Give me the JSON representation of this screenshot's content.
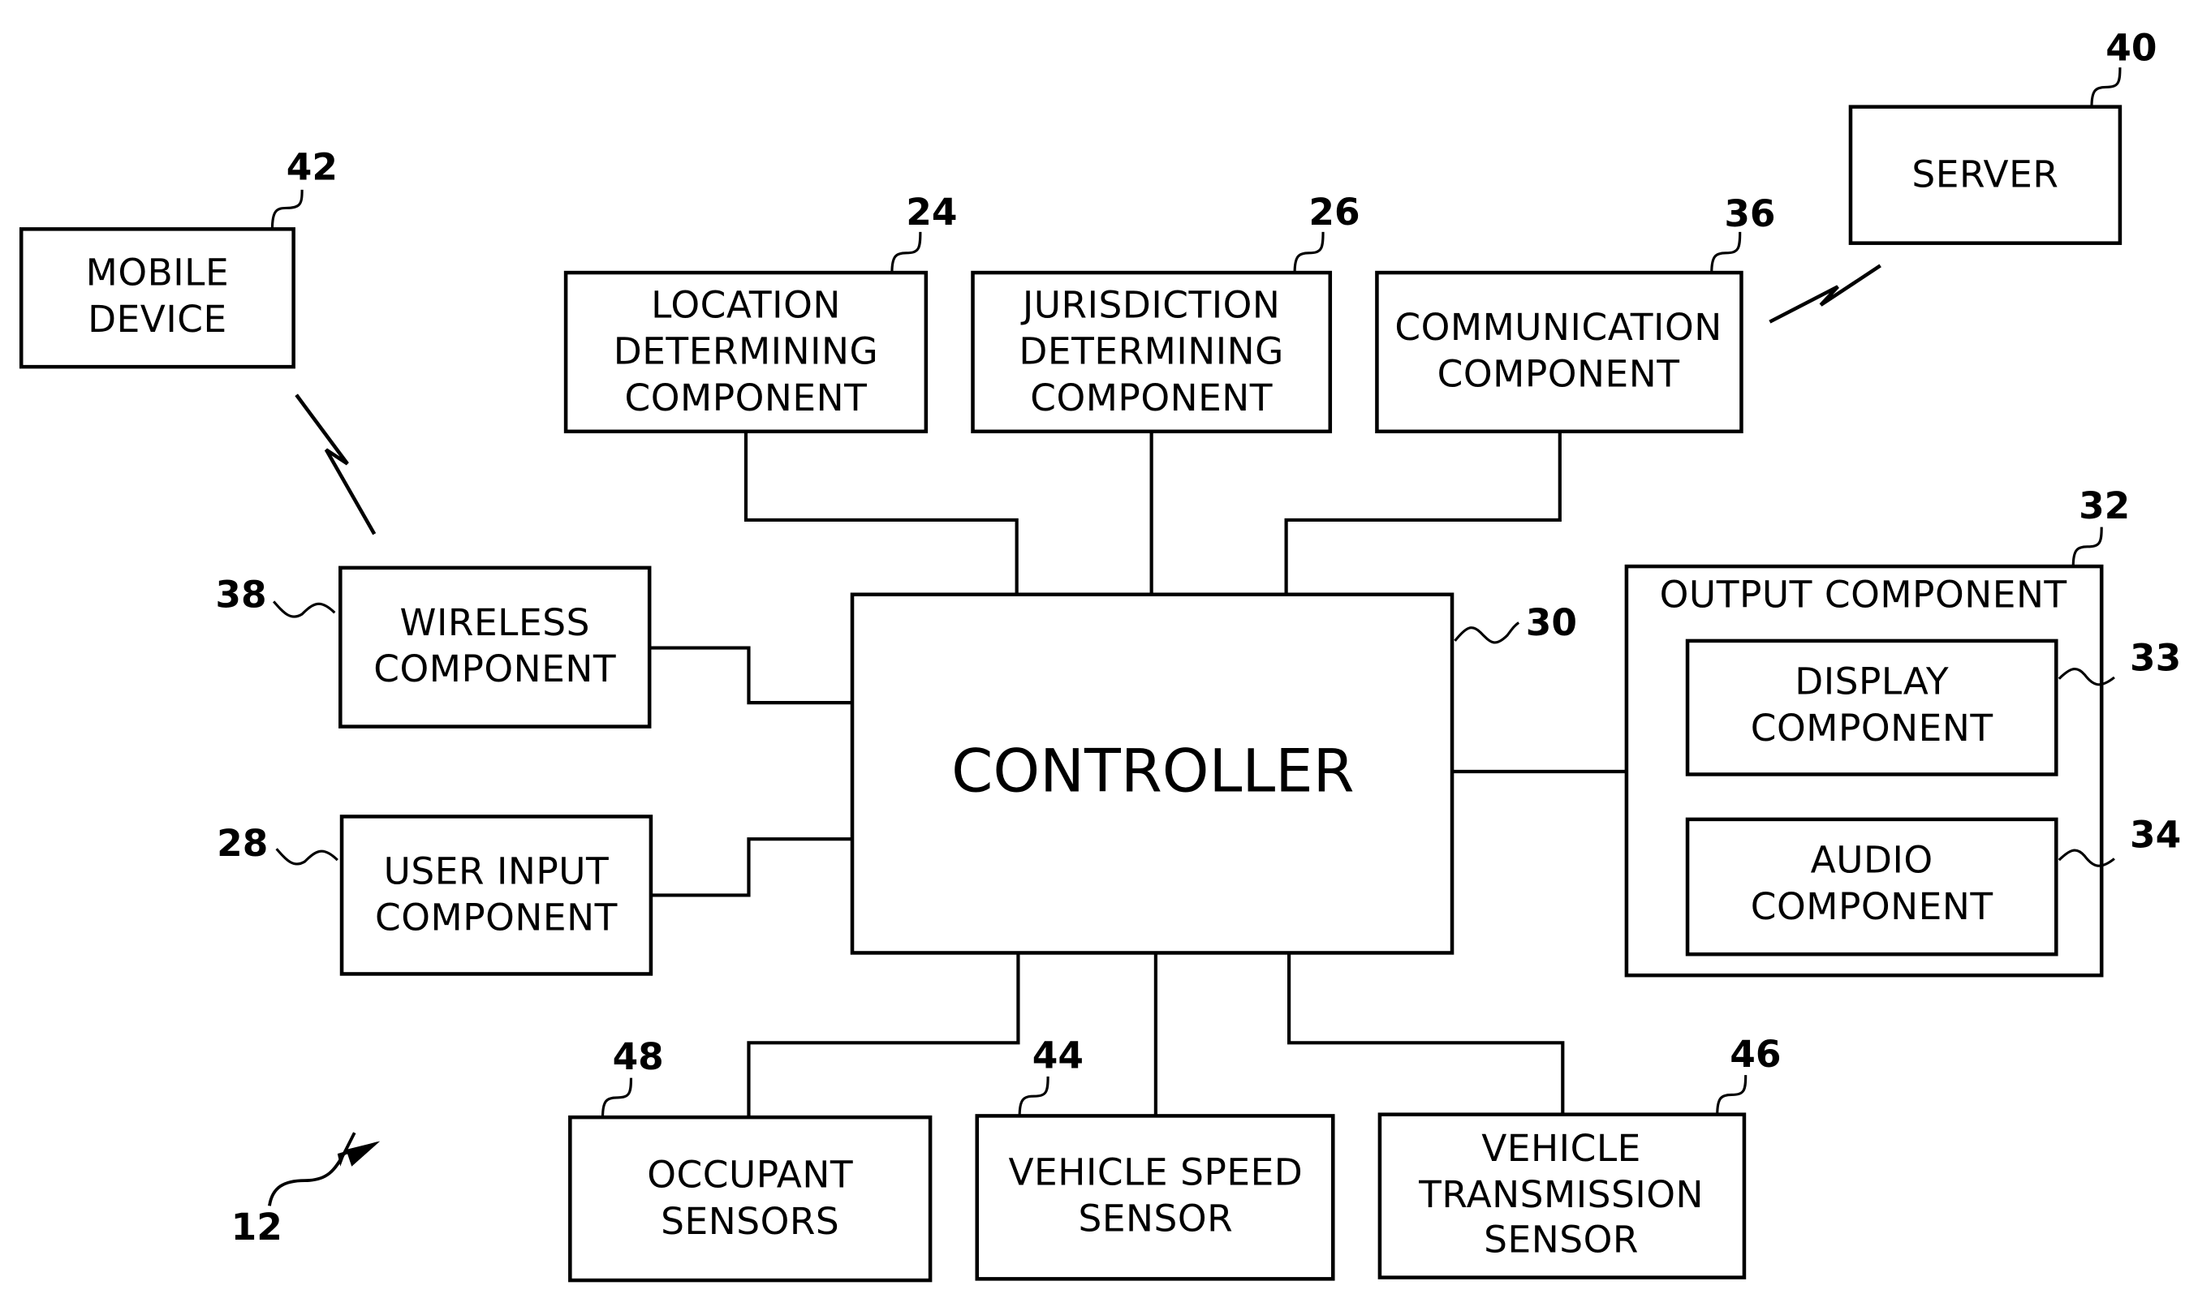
{
  "diagram": {
    "type": "block-diagram",
    "system_ref": "12",
    "blocks": {
      "mobile_device": {
        "ref": "42",
        "lines": [
          "MOBILE",
          "DEVICE"
        ]
      },
      "location": {
        "ref": "24",
        "lines": [
          "LOCATION",
          "DETERMINING",
          "COMPONENT"
        ]
      },
      "jurisdiction": {
        "ref": "26",
        "lines": [
          "JURISDICTION",
          "DETERMINING",
          "COMPONENT"
        ]
      },
      "communication": {
        "ref": "36",
        "lines": [
          "COMMUNICATION",
          "COMPONENT"
        ]
      },
      "server": {
        "ref": "40",
        "lines": [
          "SERVER"
        ]
      },
      "wireless": {
        "ref": "38",
        "lines": [
          "WIRELESS",
          "COMPONENT"
        ]
      },
      "user_input": {
        "ref": "28",
        "lines": [
          "USER INPUT",
          "COMPONENT"
        ]
      },
      "controller": {
        "ref": "30",
        "lines": [
          "CONTROLLER"
        ]
      },
      "output": {
        "ref": "32",
        "lines": [
          "OUTPUT COMPONENT"
        ]
      },
      "display": {
        "ref": "33",
        "lines": [
          "DISPLAY",
          "COMPONENT"
        ]
      },
      "audio": {
        "ref": "34",
        "lines": [
          "AUDIO",
          "COMPONENT"
        ]
      },
      "occupant": {
        "ref": "48",
        "lines": [
          "OCCUPANT",
          "SENSORS"
        ]
      },
      "speed": {
        "ref": "44",
        "lines": [
          "VEHICLE SPEED",
          "SENSOR"
        ]
      },
      "transmission": {
        "ref": "46",
        "lines": [
          "VEHICLE",
          "TRANSMISSION",
          "SENSOR"
        ]
      }
    },
    "connections": [
      [
        "location",
        "controller"
      ],
      [
        "jurisdiction",
        "controller"
      ],
      [
        "communication",
        "controller"
      ],
      [
        "wireless",
        "controller"
      ],
      [
        "user_input",
        "controller"
      ],
      [
        "controller",
        "output"
      ],
      [
        "occupant",
        "controller"
      ],
      [
        "speed",
        "controller"
      ],
      [
        "transmission",
        "controller"
      ]
    ],
    "wireless_links": [
      [
        "mobile_device",
        "wireless"
      ],
      [
        "communication",
        "server"
      ]
    ]
  }
}
